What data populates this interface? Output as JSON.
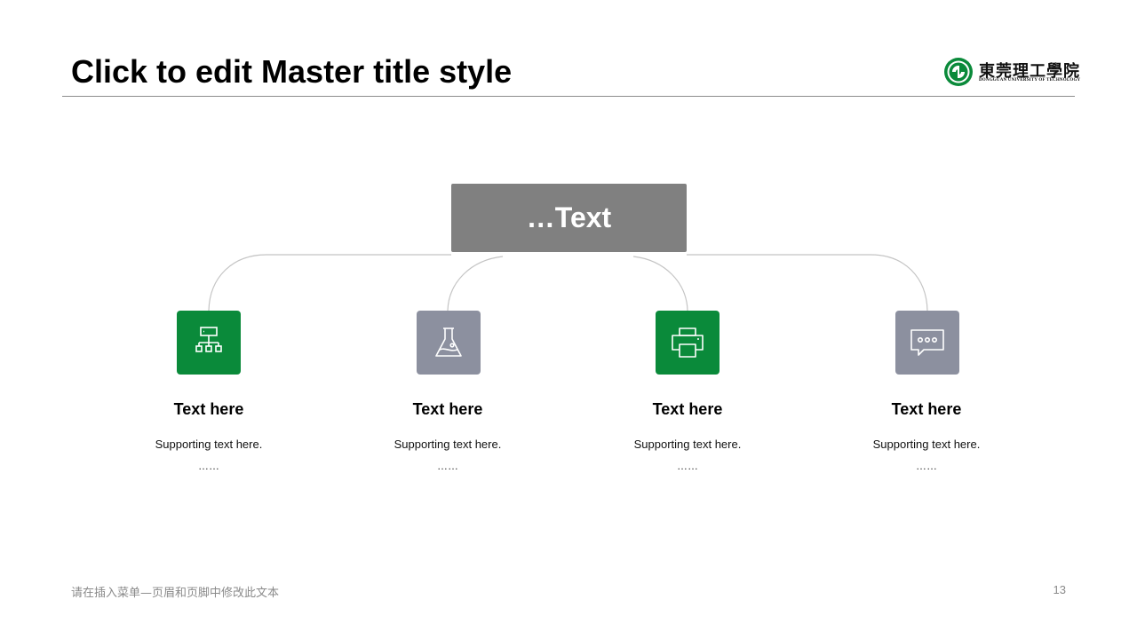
{
  "slide": {
    "title": "Click to edit Master title style",
    "center_label": "…Text",
    "footer_text": "请在插入菜单—页眉和页脚中修改此文本",
    "page_number": "13"
  },
  "logo": {
    "name_cn": "東莞理工學院",
    "name_en": "DONGGUAN UNIVERSITY OF TECHNOLOGY",
    "color": "#0a8a3a"
  },
  "colors": {
    "green": "#0a8a3a",
    "gray_tile": "#8c909f",
    "center_box": "#808080",
    "connector": "#bfbfbf"
  },
  "items": [
    {
      "title": "Text here",
      "subtitle": "Supporting  text here.",
      "dots": "……",
      "icon": "hierarchy-icon",
      "tile_color": "green"
    },
    {
      "title": "Text here",
      "subtitle": "Supporting  text here.",
      "dots": "……",
      "icon": "flask-icon",
      "tile_color": "gray"
    },
    {
      "title": "Text here",
      "subtitle": "Supporting  text here.",
      "dots": "……",
      "icon": "printer-icon",
      "tile_color": "green"
    },
    {
      "title": "Text here",
      "subtitle": "Supporting  text here.",
      "dots": "……",
      "icon": "chat-bubble-icon",
      "tile_color": "gray"
    }
  ]
}
